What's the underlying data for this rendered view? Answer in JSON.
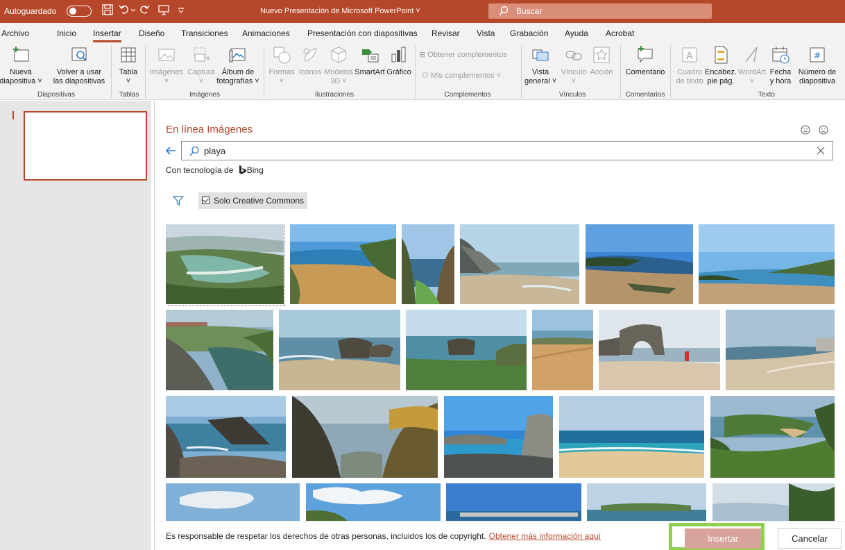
{
  "titlebar": {
    "autosave_label": "Autoguardado",
    "document_title": "Nuevo Presentación de Microsoft PowerPoint",
    "search_placeholder": "Buscar",
    "accent": "#b7472a"
  },
  "tabs": [
    "Archivo",
    "Inicio",
    "Insertar",
    "Diseño",
    "Transiciones",
    "Animaciones",
    "Presentación con diapositivas",
    "Revisar",
    "Vista",
    "Grabación",
    "Ayuda",
    "Acrobat"
  ],
  "active_tab": "Insertar",
  "ribbon": {
    "nueva": [
      "Nueva",
      "diapositiva ˅"
    ],
    "volver": [
      "Volver a usar",
      "las diapositivas"
    ],
    "tabla": [
      "Tabla",
      "˅"
    ],
    "imagenes": [
      "Imágenes",
      "˅"
    ],
    "captura": [
      "Captura",
      "˅"
    ],
    "album": [
      "Álbum de",
      "fotografías ˅"
    ],
    "formas": [
      "Formas",
      "˅"
    ],
    "iconos": "Iconos",
    "modelos": [
      "Modelos",
      "3D ˅"
    ],
    "smartart": "SmartArt",
    "grafico": "Gráfico",
    "obtener": "Obtener complementos",
    "mis": "Mis complementos",
    "vista": [
      "Vista",
      "general ˅"
    ],
    "vinculo": [
      "Vínculo",
      "˅"
    ],
    "accion": "Acción",
    "comentario": "Comentario",
    "cuadro": [
      "Cuadro",
      "de texto"
    ],
    "encabez": [
      "Encabez.",
      "pie pág."
    ],
    "wordart": [
      "WordArt",
      "˅"
    ],
    "fecha": [
      "Fecha",
      "y hora"
    ],
    "numero": [
      "Número de",
      "diapositiva"
    ],
    "groups": {
      "diapositivas": "Diapositivas",
      "tablas": "Tablas",
      "imagenes": "Imágenes",
      "ilustraciones": "Ilustraciones",
      "complementos": "Complementos",
      "vinculos": "Vínculos",
      "comentarios": "Comentarios",
      "texto": "Texto"
    }
  },
  "dialog": {
    "title": "En línea Imágenes",
    "search_value": "playa",
    "powered_by": "Con tecnología de",
    "bing": "Bing",
    "filter_label": "Solo Creative Commons",
    "legal_text": "Es responsable de respetar los derechos de otras personas, incluidos los de copyright.",
    "legal_link": "Obtener más información aquí",
    "insert_button": "Insertar",
    "cancel_button": "Cancelar",
    "image_count_visible": 23
  }
}
